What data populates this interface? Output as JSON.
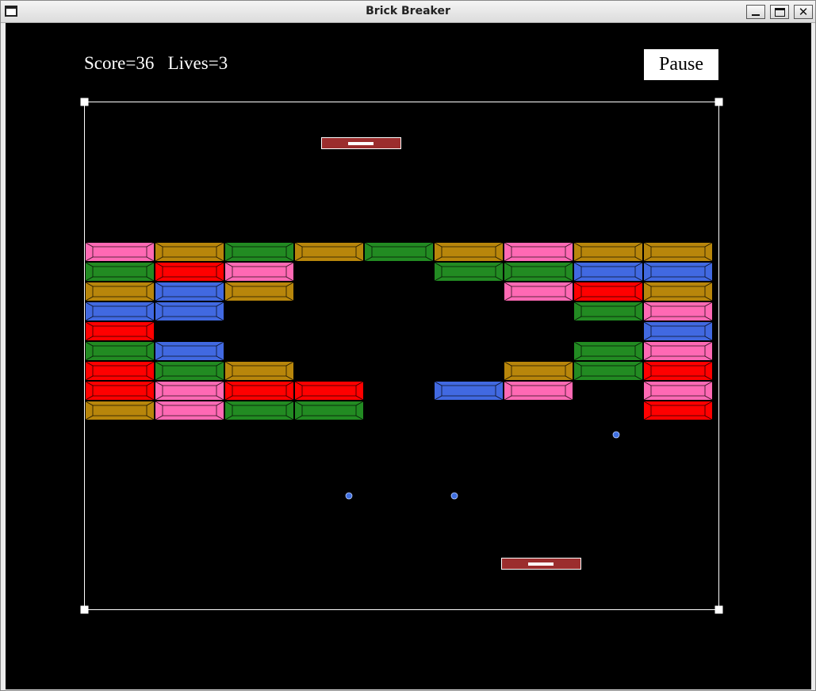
{
  "window": {
    "title": "Brick Breaker",
    "icons": [
      "window-menu-icon",
      "minimize-icon",
      "maximize-icon",
      "close-icon"
    ]
  },
  "hud": {
    "score_label": "Score",
    "score": 36,
    "lives_label": "Lives",
    "lives": 3,
    "pause_label": "Pause"
  },
  "colors": {
    "background": "#000000",
    "field_border": "#ffffff",
    "paddle": "#9b2d2d",
    "paddle_grip": "#ffffff",
    "ball": "#3f6fe0",
    "bricks": {
      "pink": "#ff69b4",
      "gold": "#b8860b",
      "green": "#228b22",
      "red": "#ff0000",
      "blue": "#4169e1"
    }
  },
  "bricks": [
    [
      "pink",
      "gold",
      "green",
      "gold",
      "green",
      "gold",
      "pink",
      "gold",
      "gold"
    ],
    [
      "green",
      "red",
      "pink",
      null,
      null,
      "green",
      "green",
      "blue",
      "blue"
    ],
    [
      "gold",
      "blue",
      "gold",
      null,
      null,
      null,
      "pink",
      "red",
      "gold"
    ],
    [
      "blue",
      "blue",
      null,
      null,
      null,
      null,
      null,
      "green",
      "pink"
    ],
    [
      "red",
      null,
      null,
      null,
      null,
      null,
      null,
      null,
      "blue"
    ],
    [
      "green",
      "blue",
      null,
      null,
      null,
      null,
      null,
      "green",
      "pink"
    ],
    [
      "red",
      "green",
      "gold",
      null,
      null,
      null,
      "gold",
      "green",
      "red"
    ],
    [
      "red",
      "pink",
      "red",
      "red",
      null,
      "blue",
      "pink",
      null,
      "pink"
    ],
    [
      "gold",
      "pink",
      "green",
      "green",
      null,
      null,
      null,
      null,
      "red"
    ]
  ],
  "entities": {
    "paddles": [
      "top-paddle",
      "bottom-paddle"
    ],
    "ball_count": 3
  }
}
